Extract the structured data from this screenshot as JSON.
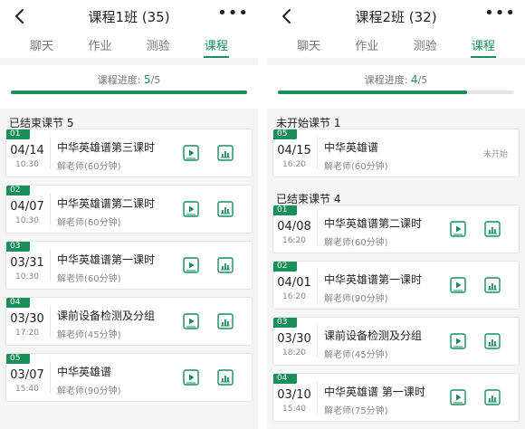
{
  "theme": {
    "accent": "#1a8f5a"
  },
  "panels": [
    {
      "title": "课程1班 (35)",
      "tabs": [
        "聊天",
        "作业",
        "测验",
        "课程"
      ],
      "active_tab": "课程",
      "progress_label": "课程进度:",
      "progress_current": "5",
      "progress_total": "/5",
      "progress_fraction": 1.0,
      "upcoming_header": "",
      "upcoming": [],
      "ended_header": "已结束课节 5",
      "ended": [
        {
          "num": "01",
          "date": "04/14",
          "time": "10:30",
          "title": "中华英雄谱第三课时",
          "teacher": "解老师(60分钟)"
        },
        {
          "num": "02",
          "date": "04/07",
          "time": "10:30",
          "title": "中华英雄谱第二课时",
          "teacher": "解老师(60分钟)"
        },
        {
          "num": "03",
          "date": "03/31",
          "time": "10:30",
          "title": "中华英雄谱第一课时",
          "teacher": "解老师(60分钟)"
        },
        {
          "num": "04",
          "date": "03/30",
          "time": "17:20",
          "title": "课前设备检测及分组",
          "teacher": "解老师(45分钟)"
        },
        {
          "num": "05",
          "date": "03/07",
          "time": "15:40",
          "title": "中华英雄谱",
          "teacher": "解老师(90分钟)"
        }
      ]
    },
    {
      "title": "课程2班 (32)",
      "tabs": [
        "聊天",
        "作业",
        "测验",
        "课程"
      ],
      "active_tab": "课程",
      "progress_label": "课程进度:",
      "progress_current": "4",
      "progress_total": "/5",
      "progress_fraction": 0.8,
      "upcoming_header": "未开始课节 1",
      "upcoming": [
        {
          "num": "05",
          "date": "04/15",
          "time": "16:20",
          "title": "中华英雄谱",
          "teacher": "解老师(60分钟)",
          "status": "未开始"
        }
      ],
      "ended_header": "已结束课节 4",
      "ended": [
        {
          "num": "01",
          "date": "04/08",
          "time": "16:20",
          "title": "中华英雄谱第二课时",
          "teacher": "解老师(60分钟)"
        },
        {
          "num": "02",
          "date": "04/01",
          "time": "16:20",
          "title": "中华英雄谱第一课时",
          "teacher": "解老师(90分钟)"
        },
        {
          "num": "03",
          "date": "03/30",
          "time": "18:20",
          "title": "课前设备检测及分组",
          "teacher": "解老师(45分钟)"
        },
        {
          "num": "04",
          "date": "03/10",
          "time": "15:40",
          "title": "中华英雄谱 第一课时",
          "teacher": "解老师(75分钟)"
        }
      ]
    }
  ]
}
